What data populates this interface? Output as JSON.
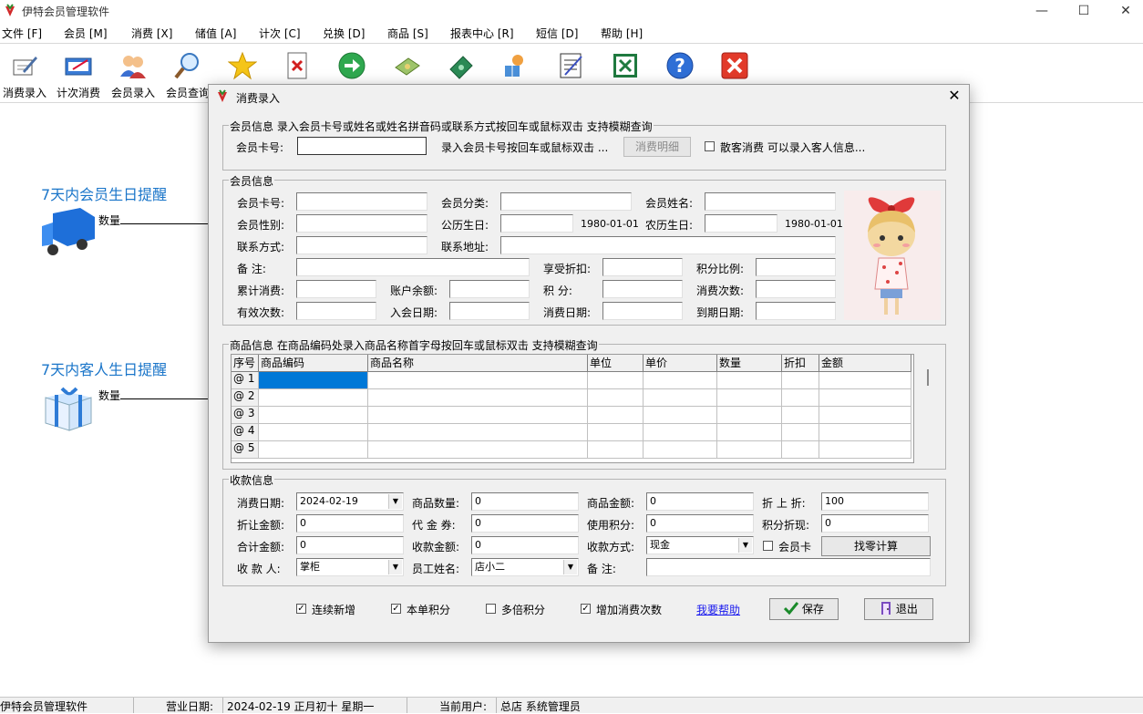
{
  "app": {
    "title": "伊特会员管理软件"
  },
  "window_buttons": {
    "minimize": "—",
    "maximize": "☐",
    "close": "✕"
  },
  "menu": [
    "文件 [F]",
    "会员 [M]",
    "消费 [X]",
    "储值 [A]",
    "计次 [C]",
    "兑换 [D]",
    "商品 [S]",
    "报表中心 [R]",
    "短信 [D]",
    "帮助 [H]"
  ],
  "toolbar": [
    {
      "label": "消费录入",
      "icon": "pen-notepad-icon"
    },
    {
      "label": "计次消费",
      "icon": "card-pen-icon"
    },
    {
      "label": "会员录入",
      "icon": "users-icon"
    },
    {
      "label": "会员查询",
      "icon": "magnifier-icon"
    },
    {
      "label": "",
      "icon": "star-icon"
    },
    {
      "label": "",
      "icon": "delete-document-icon"
    },
    {
      "label": "",
      "icon": "green-arrow-icon"
    },
    {
      "label": "",
      "icon": "money-icon"
    },
    {
      "label": "",
      "icon": "cash-transfer-icon"
    },
    {
      "label": "",
      "icon": "gift-person-icon"
    },
    {
      "label": "",
      "icon": "notepad-icon"
    },
    {
      "label": "",
      "icon": "excel-icon"
    },
    {
      "label": "",
      "icon": "help-icon"
    },
    {
      "label": "",
      "icon": "exit-icon"
    }
  ],
  "left_panel": {
    "member_birthday": {
      "title": "7天内会员生日提醒",
      "qty_label": "数量"
    },
    "guest_birthday": {
      "title": "7天内客人生日提醒",
      "qty_label": "数量"
    }
  },
  "statusbar": {
    "app": "伊特会员管理软件",
    "business_date_label": "营业日期:",
    "business_date": "2024-02-19  正月初十  星期一",
    "user_label": "当前用户:",
    "user": "总店 系统管理员"
  },
  "dialog": {
    "title": "消费录入",
    "lookup": {
      "group_title": "会员信息 录入会员卡号或姓名或姓名拼音码或联系方式按回车或鼠标双击 支持模糊查询",
      "card_label": "会员卡号:",
      "card_value": "",
      "hint": "录入会员卡号按回车或鼠标双击 ...",
      "detail_button": "消费明细",
      "guest_checkbox": "散客消费 可以录入客人信息..."
    },
    "member": {
      "group_title": "会员信息",
      "card_label": "会员卡号:",
      "category_label": "会员分类:",
      "name_label": "会员姓名:",
      "gender_label": "会员性别:",
      "solar_birthday_label": "公历生日:",
      "solar_birthday_value": "1980-01-01",
      "lunar_birthday_label": "农历生日:",
      "lunar_birthday_value": "1980-01-01",
      "contact_label": "联系方式:",
      "address_label": "联系地址:",
      "remark_label": "备    注:",
      "discount_label": "享受折扣:",
      "points_ratio_label": "积分比例:",
      "total_spend_label": "累计消费:",
      "balance_label": "账户余额:",
      "points_label": "积    分:",
      "visits_label": "消费次数:",
      "valid_count_label": "有效次数:",
      "join_date_label": "入会日期:",
      "spend_date_label": "消费日期:",
      "expire_date_label": "到期日期:"
    },
    "goods": {
      "group_title": "商品信息 在商品编码处录入商品名称首字母按回车或鼠标双击 支持模糊查询",
      "columns": [
        "序号",
        "商品编码",
        "商品名称",
        "单位",
        "单价",
        "数量",
        "折扣",
        "金额"
      ],
      "rows": [
        "@ 1",
        "@ 2",
        "@ 3",
        "@ 4",
        "@ 5"
      ]
    },
    "payment": {
      "group_title": "收款信息",
      "spend_date_label": "消费日期:",
      "spend_date_value": "2024-02-19",
      "goods_qty_label": "商品数量:",
      "goods_qty_value": "0",
      "goods_amount_label": "商品金额:",
      "goods_amount_value": "0",
      "discount_label": "折 上 折:",
      "discount_value": "100",
      "discount_amount_label": "折让金额:",
      "discount_amount_value": "0",
      "voucher_label": "代 金 券:",
      "voucher_value": "0",
      "points_used_label": "使用积分:",
      "points_used_value": "0",
      "points_cash_label": "积分折现:",
      "points_cash_value": "0",
      "total_label": "合计金额:",
      "total_value": "0",
      "received_label": "收款金额:",
      "received_value": "0",
      "method_label": "收款方式:",
      "method_value": "现金",
      "member_card_checkbox": "会员卡",
      "change_button": "找零计算",
      "cashier_label": "收 款 人:",
      "cashier_value": "掌柜",
      "staff_label": "员工姓名:",
      "staff_value": "店小二",
      "remark_label": "备    注:",
      "remark_value": ""
    },
    "footer": {
      "continuous_add": "连续新增",
      "single_points": "本单积分",
      "multi_points": "多倍积分",
      "add_visits": "增加消费次数",
      "help_link": "我要帮助",
      "save": "保存",
      "exit": "退出"
    }
  },
  "colors": {
    "link": "#1a75c9",
    "grid_selected": "#0078d7"
  }
}
